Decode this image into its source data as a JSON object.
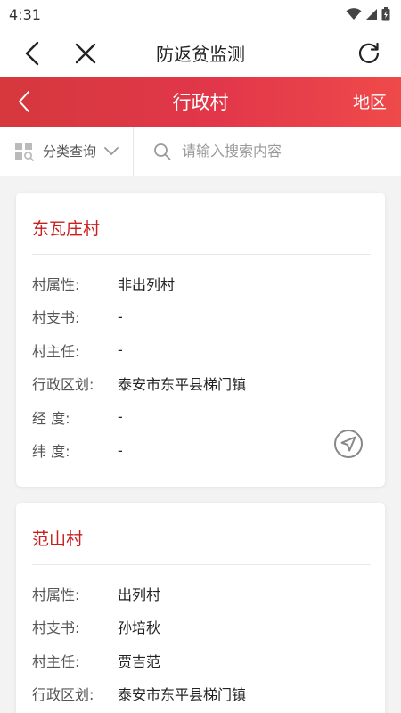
{
  "status_bar": {
    "time": "4:31"
  },
  "app_bar": {
    "title": "防返贫监测"
  },
  "sub_header": {
    "title": "行政村",
    "region_label": "地区"
  },
  "filter": {
    "category_label": "分类查询",
    "search_placeholder": "请输入搜索内容"
  },
  "labels": {
    "attribute": "村属性:",
    "secretary": "村支书:",
    "director": "村主任:",
    "division": "行政区划:",
    "longitude": "经 度:",
    "latitude": "纬 度:"
  },
  "villages": [
    {
      "name": "东瓦庄村",
      "attribute": "非出列村",
      "secretary": "-",
      "director": "-",
      "division": "泰安市东平县梯门镇",
      "longitude": "-",
      "latitude": "-"
    },
    {
      "name": "范山村",
      "attribute": "出列村",
      "secretary": "孙培秋",
      "director": "贾吉范",
      "division": "泰安市东平县梯门镇"
    }
  ],
  "colors": {
    "accent": "#d5383d",
    "title_red": "#c8201f"
  }
}
